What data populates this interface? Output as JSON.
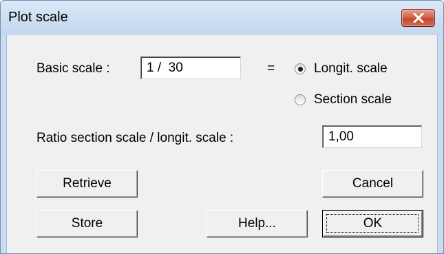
{
  "window": {
    "title": "Plot scale",
    "close_icon": "close-icon",
    "accent_close": "#c9523a"
  },
  "basic_scale": {
    "label": "Basic scale :",
    "value": "1 /  30",
    "equals": "="
  },
  "scale_type": {
    "options": [
      {
        "label": "Longit. scale",
        "selected": true
      },
      {
        "label": "Section scale",
        "selected": false
      }
    ]
  },
  "ratio": {
    "label": "Ratio section scale / longit. scale :",
    "value": "1,00"
  },
  "buttons": {
    "retrieve": "Retrieve",
    "cancel": "Cancel",
    "store": "Store",
    "help": "Help...",
    "ok": "OK"
  }
}
